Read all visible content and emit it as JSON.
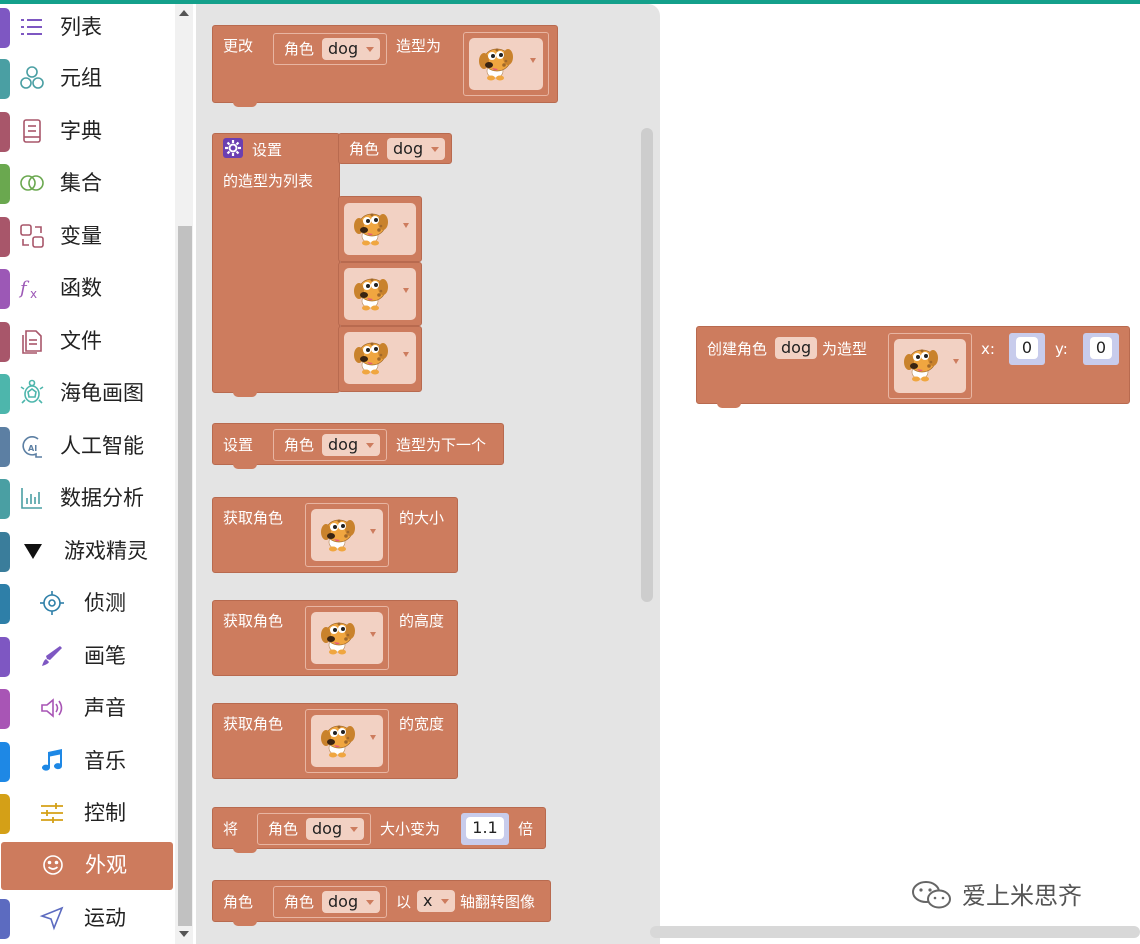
{
  "sidebar": {
    "items": [
      {
        "label": "列表",
        "color": "#7e57c2",
        "icon": "list-icon"
      },
      {
        "label": "元组",
        "color": "#4a9fa3",
        "icon": "tuple-icon"
      },
      {
        "label": "字典",
        "color": "#a8566a",
        "icon": "dictionary-icon"
      },
      {
        "label": "集合",
        "color": "#6aa84f",
        "icon": "set-icon"
      },
      {
        "label": "变量",
        "color": "#a8566a",
        "icon": "variable-icon"
      },
      {
        "label": "函数",
        "color": "#9c58b6",
        "icon": "function-icon"
      },
      {
        "label": "文件",
        "color": "#a8566a",
        "icon": "file-icon"
      },
      {
        "label": "海龟画图",
        "color": "#4db6ac",
        "icon": "turtle-icon"
      },
      {
        "label": "人工智能",
        "color": "#5c7fa3",
        "icon": "ai-icon"
      },
      {
        "label": "数据分析",
        "color": "#4a9fa3",
        "icon": "data-analysis-icon"
      },
      {
        "label": "游戏精灵",
        "color": "#3a7d9b",
        "icon": "caret-down-icon"
      },
      {
        "label": "侦测",
        "color": "#2e7fa8",
        "icon": "sensing-icon"
      },
      {
        "label": "画笔",
        "color": "#7e57c2",
        "icon": "pen-icon"
      },
      {
        "label": "声音",
        "color": "#a855b5",
        "icon": "sound-icon"
      },
      {
        "label": "音乐",
        "color": "#1e88e5",
        "icon": "music-icon"
      },
      {
        "label": "控制",
        "color": "#d4a017",
        "icon": "control-icon"
      },
      {
        "label": "外观",
        "color": "#cd7b5d",
        "icon": "looks-icon"
      },
      {
        "label": "运动",
        "color": "#5c6bc0",
        "icon": "motion-icon"
      }
    ]
  },
  "blocks": {
    "b1": {
      "prefix": "更改",
      "sprite_label": "角色",
      "sprite": "dog",
      "suffix": "造型为"
    },
    "b2": {
      "title": "设置",
      "line2": "的造型为列表",
      "sprite_label": "角色",
      "sprite": "dog"
    },
    "b3": {
      "prefix": "设置",
      "sprite_label": "角色",
      "sprite": "dog",
      "suffix": "造型为下一个"
    },
    "b4": {
      "prefix": "获取角色",
      "suffix": "的大小"
    },
    "b5": {
      "prefix": "获取角色",
      "suffix": "的高度"
    },
    "b6": {
      "prefix": "获取角色",
      "suffix": "的宽度"
    },
    "b7": {
      "prefix": "将",
      "sprite_label": "角色",
      "sprite": "dog",
      "middle": "大小变为",
      "value": "1.1",
      "suffix": "倍"
    },
    "b8": {
      "prefix": "角色",
      "sprite_label": "角色",
      "sprite": "dog",
      "middle": "以",
      "axis": "x",
      "suffix": "轴翻转图像"
    }
  },
  "workspace": {
    "create": {
      "prefix": "创建角色",
      "sprite": "dog",
      "middle": "为造型",
      "x_label": "x:",
      "x": "0",
      "y_label": "y:",
      "y": "0"
    }
  },
  "watermark": "爱上米思齐",
  "colors": {
    "looks": "#cd7c5e",
    "accent": "#14a08b"
  }
}
